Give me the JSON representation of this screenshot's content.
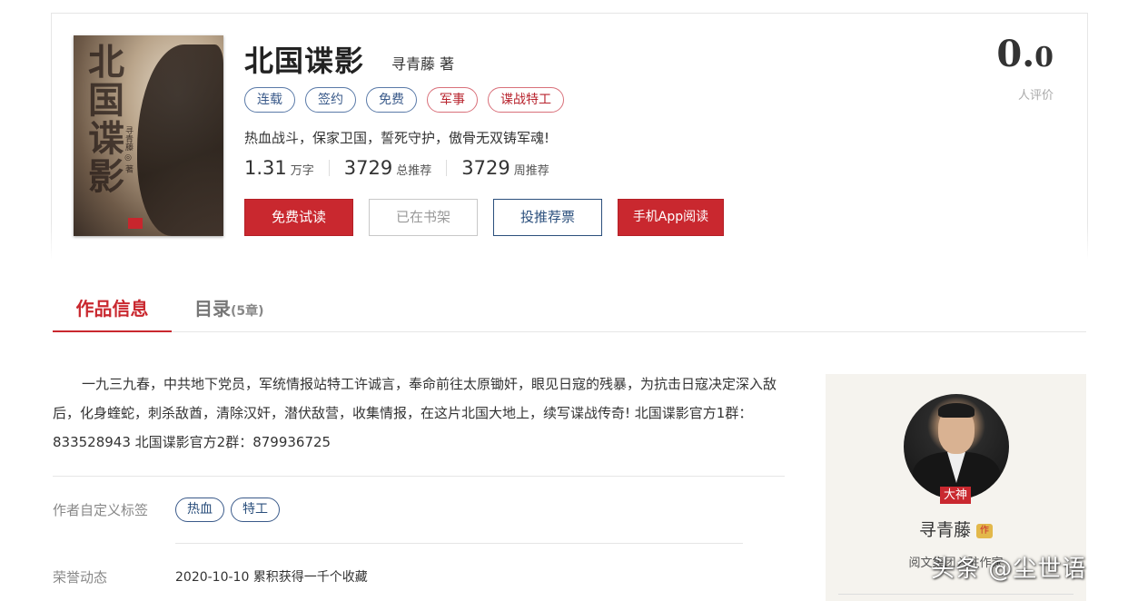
{
  "book": {
    "cover": {
      "title": "北国谍影",
      "author": "寻青藤 ◎ 著"
    },
    "title": "北国谍影",
    "author": "寻青藤 著",
    "tags": [
      {
        "label": "连载",
        "style": "blue"
      },
      {
        "label": "签约",
        "style": "blue"
      },
      {
        "label": "免费",
        "style": "blue"
      },
      {
        "label": "军事",
        "style": "red"
      },
      {
        "label": "谍战特工",
        "style": "red"
      }
    ],
    "intro": "热血战斗，保家卫国，誓死守护，傲骨无双铸军魂!",
    "stats": {
      "words": {
        "num": "1.31",
        "unit": "万字"
      },
      "total_rec": {
        "num": "3729",
        "unit": "总推荐"
      },
      "week_rec": {
        "num": "3729",
        "unit": "周推荐"
      }
    },
    "actions": {
      "read": "免费试读",
      "shelf": "已在书架",
      "vote": "投推荐票",
      "app": "手机App阅读"
    },
    "rating": {
      "int": "0.",
      "dec": "0",
      "label": "人评价"
    }
  },
  "tabs": {
    "info": "作品信息",
    "toc": "目录",
    "toc_count": "(5章)"
  },
  "description": "一九三九春，中共地下党员，军统情报站特工许诚言，奉命前往太原锄奸，眼见日寇的残暴，为抗击日寇决定深入敌后，化身蝰蛇，刺杀敌酋，清除汉奸，潜伏敌营，收集情报，在这片北国大地上，续写谍战传奇! 北国谍影官方1群：833528943 北国谍影官方2群：879936725",
  "custom_tags": {
    "label": "作者自定义标签",
    "items": [
      "热血",
      "特工"
    ]
  },
  "honor": {
    "label": "荣誉动态",
    "text": "2020-10-10 累积获得一千个收藏"
  },
  "author_panel": {
    "badge": "大神",
    "name": "寻青藤",
    "level_icon": "作",
    "sub": "阅文集团入驻作家"
  },
  "watermark": "头条 @尘世语",
  "colors": {
    "accent_red": "#c9282f",
    "tag_blue": "#3a5a8a",
    "panel_bg": "#f5f3ee"
  }
}
